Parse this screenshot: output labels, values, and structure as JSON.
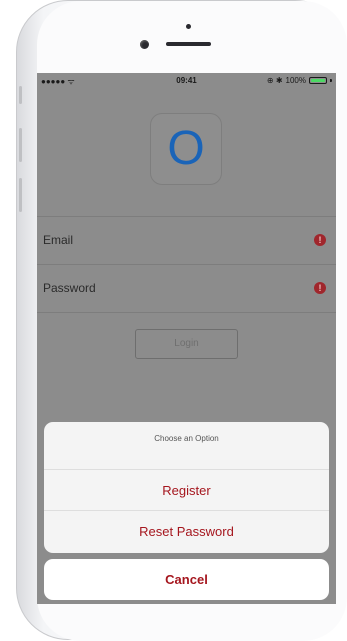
{
  "status_bar": {
    "signal": "●●●●● ",
    "wifi_icon": "wifi-icon",
    "time": "09:41",
    "right_icons": "⊕ ✱",
    "battery_percent": "100%",
    "battery_level": 1.0,
    "battery_color": "#4cd964"
  },
  "app": {
    "logo_letter": "O",
    "logo_color": "#1a64b8"
  },
  "form": {
    "email_label": "Email",
    "password_label": "Password",
    "error_glyph": "!",
    "login_label": "Login"
  },
  "action_sheet": {
    "title": "Choose an Option",
    "actions": [
      {
        "label": "Register"
      },
      {
        "label": "Reset Password"
      }
    ],
    "cancel_label": "Cancel",
    "accent_color": "#a5161e"
  }
}
